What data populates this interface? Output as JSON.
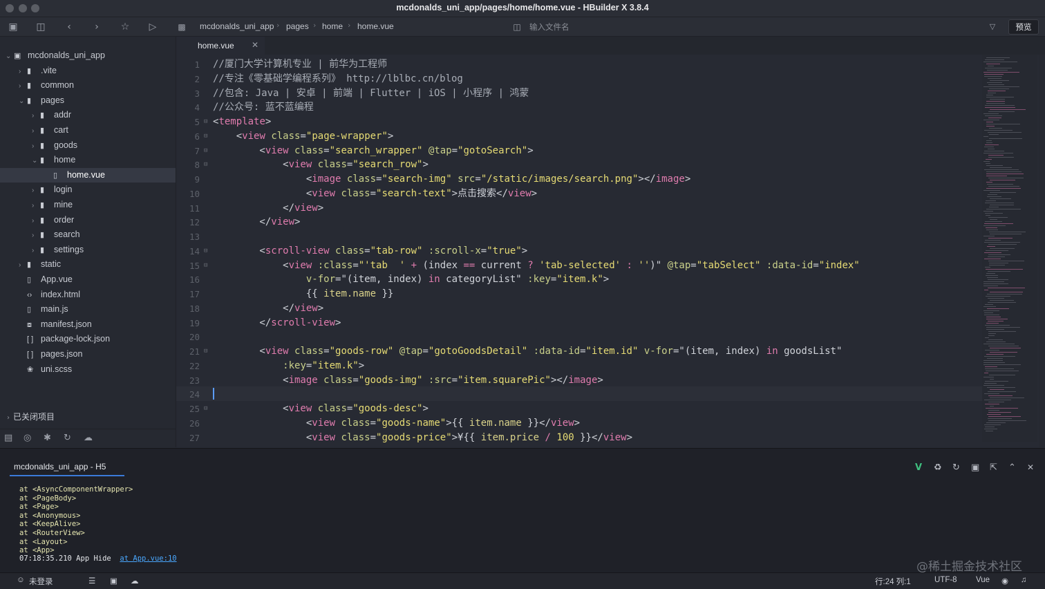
{
  "window": {
    "title": "mcdonalds_uni_app/pages/home/home.vue - HBuilder X 3.8.4"
  },
  "toolbar": {
    "breadcrumb": [
      "mcdonalds_uni_app",
      "pages",
      "home",
      "home.vue"
    ],
    "file_search_placeholder": "输入文件名",
    "preview_label": "预览"
  },
  "sidebar": {
    "items": [
      {
        "label": "mcdonalds_uni_app",
        "depth": 0,
        "kind": "project",
        "expanded": true
      },
      {
        "label": ".vite",
        "depth": 1,
        "kind": "folder",
        "expanded": false
      },
      {
        "label": "common",
        "depth": 1,
        "kind": "folder",
        "expanded": false
      },
      {
        "label": "pages",
        "depth": 1,
        "kind": "folder",
        "expanded": true
      },
      {
        "label": "addr",
        "depth": 2,
        "kind": "folder",
        "expanded": false
      },
      {
        "label": "cart",
        "depth": 2,
        "kind": "folder",
        "expanded": false
      },
      {
        "label": "goods",
        "depth": 2,
        "kind": "folder",
        "expanded": false
      },
      {
        "label": "home",
        "depth": 2,
        "kind": "folder",
        "expanded": true
      },
      {
        "label": "home.vue",
        "depth": 3,
        "kind": "file",
        "selected": true
      },
      {
        "label": "login",
        "depth": 2,
        "kind": "folder",
        "expanded": false
      },
      {
        "label": "mine",
        "depth": 2,
        "kind": "folder",
        "expanded": false
      },
      {
        "label": "order",
        "depth": 2,
        "kind": "folder",
        "expanded": false
      },
      {
        "label": "search",
        "depth": 2,
        "kind": "folder",
        "expanded": false
      },
      {
        "label": "settings",
        "depth": 2,
        "kind": "folder",
        "expanded": false
      },
      {
        "label": "static",
        "depth": 1,
        "kind": "folder",
        "expanded": false
      },
      {
        "label": "App.vue",
        "depth": 1,
        "kind": "file"
      },
      {
        "label": "index.html",
        "depth": 1,
        "kind": "html"
      },
      {
        "label": "main.js",
        "depth": 1,
        "kind": "file"
      },
      {
        "label": "manifest.json",
        "depth": 1,
        "kind": "manifest"
      },
      {
        "label": "package-lock.json",
        "depth": 1,
        "kind": "json"
      },
      {
        "label": "pages.json",
        "depth": 1,
        "kind": "json"
      },
      {
        "label": "uni.scss",
        "depth": 1,
        "kind": "scss"
      }
    ],
    "closed_projects_label": "已关闭项目"
  },
  "editor": {
    "tab_label": "home.vue",
    "cursor_line": 24,
    "lines": [
      {
        "n": "1",
        "fold": false,
        "tokens": [
          [
            "c-cm",
            "//厦门大学计算机专业 | 前华为工程师"
          ]
        ]
      },
      {
        "n": "2",
        "fold": false,
        "tokens": [
          [
            "c-cm",
            "//专注《零基础学编程系列》 http://lblbc.cn/blog"
          ]
        ]
      },
      {
        "n": "3",
        "fold": false,
        "tokens": [
          [
            "c-cm",
            "//包含: Java | 安卓 | 前端 | Flutter | iOS | 小程序 | 鸿蒙"
          ]
        ]
      },
      {
        "n": "4",
        "fold": false,
        "tokens": [
          [
            "c-cm",
            "//公众号: 蓝不蓝编程"
          ]
        ]
      },
      {
        "n": "5",
        "fold": true,
        "tokens": [
          [
            "c-plain",
            "<"
          ],
          [
            "c-tag",
            "template"
          ],
          [
            "c-plain",
            ">"
          ]
        ]
      },
      {
        "n": "6",
        "fold": true,
        "tokens": [
          [
            "c-plain",
            "    <"
          ],
          [
            "c-tag",
            "view"
          ],
          [
            "c-plain",
            " "
          ],
          [
            "c-attr",
            "class"
          ],
          [
            "c-plain",
            "="
          ],
          [
            "c-str",
            "\"page-wrapper\""
          ],
          [
            "c-plain",
            ">"
          ]
        ]
      },
      {
        "n": "7",
        "fold": true,
        "tokens": [
          [
            "c-plain",
            "        <"
          ],
          [
            "c-tag",
            "view"
          ],
          [
            "c-plain",
            " "
          ],
          [
            "c-attr",
            "class"
          ],
          [
            "c-plain",
            "="
          ],
          [
            "c-str",
            "\"search_wrapper\""
          ],
          [
            "c-plain",
            " "
          ],
          [
            "c-attr",
            "@tap"
          ],
          [
            "c-plain",
            "="
          ],
          [
            "c-str",
            "\"gotoSearch\""
          ],
          [
            "c-plain",
            ">"
          ]
        ]
      },
      {
        "n": "8",
        "fold": true,
        "tokens": [
          [
            "c-plain",
            "            <"
          ],
          [
            "c-tag",
            "view"
          ],
          [
            "c-plain",
            " "
          ],
          [
            "c-attr",
            "class"
          ],
          [
            "c-plain",
            "="
          ],
          [
            "c-str",
            "\"search_row\""
          ],
          [
            "c-plain",
            ">"
          ]
        ]
      },
      {
        "n": "9",
        "fold": false,
        "tokens": [
          [
            "c-plain",
            "                <"
          ],
          [
            "c-tag",
            "image"
          ],
          [
            "c-plain",
            " "
          ],
          [
            "c-attr",
            "class"
          ],
          [
            "c-plain",
            "="
          ],
          [
            "c-str",
            "\"search-img\""
          ],
          [
            "c-plain",
            " "
          ],
          [
            "c-attr",
            "src"
          ],
          [
            "c-plain",
            "="
          ],
          [
            "c-str",
            "\"/static/images/search.png\""
          ],
          [
            "c-plain",
            "></"
          ],
          [
            "c-tag",
            "image"
          ],
          [
            "c-plain",
            ">"
          ]
        ]
      },
      {
        "n": "10",
        "fold": false,
        "tokens": [
          [
            "c-plain",
            "                <"
          ],
          [
            "c-tag",
            "view"
          ],
          [
            "c-plain",
            " "
          ],
          [
            "c-attr",
            "class"
          ],
          [
            "c-plain",
            "="
          ],
          [
            "c-str",
            "\"search-text\""
          ],
          [
            "c-plain",
            ">点击搜索</"
          ],
          [
            "c-tag",
            "view"
          ],
          [
            "c-plain",
            ">"
          ]
        ]
      },
      {
        "n": "11",
        "fold": false,
        "tokens": [
          [
            "c-plain",
            "            </"
          ],
          [
            "c-tag",
            "view"
          ],
          [
            "c-plain",
            ">"
          ]
        ]
      },
      {
        "n": "12",
        "fold": false,
        "tokens": [
          [
            "c-plain",
            "        </"
          ],
          [
            "c-tag",
            "view"
          ],
          [
            "c-plain",
            ">"
          ]
        ]
      },
      {
        "n": "13",
        "fold": false,
        "tokens": []
      },
      {
        "n": "14",
        "fold": true,
        "tokens": [
          [
            "c-plain",
            "        <"
          ],
          [
            "c-tag",
            "scroll-view"
          ],
          [
            "c-plain",
            " "
          ],
          [
            "c-attr",
            "class"
          ],
          [
            "c-plain",
            "="
          ],
          [
            "c-str",
            "\"tab-row\""
          ],
          [
            "c-plain",
            " "
          ],
          [
            "c-attr",
            ":scroll-x"
          ],
          [
            "c-plain",
            "="
          ],
          [
            "c-str",
            "\"true\""
          ],
          [
            "c-plain",
            ">"
          ]
        ]
      },
      {
        "n": "15",
        "fold": true,
        "tokens": [
          [
            "c-plain",
            "            <"
          ],
          [
            "c-tag",
            "view"
          ],
          [
            "c-plain",
            " "
          ],
          [
            "c-attr",
            ":class"
          ],
          [
            "c-plain",
            "="
          ],
          [
            "c-str",
            "\"'tab  '"
          ],
          [
            "c-plain",
            " "
          ],
          [
            "c-kw",
            "+"
          ],
          [
            "c-plain",
            " (index "
          ],
          [
            "c-kw",
            "=="
          ],
          [
            "c-plain",
            " current "
          ],
          [
            "c-kw",
            "?"
          ],
          [
            "c-plain",
            " "
          ],
          [
            "c-str",
            "'tab-selected'"
          ],
          [
            "c-plain",
            " "
          ],
          [
            "c-kw",
            ":"
          ],
          [
            "c-plain",
            " "
          ],
          [
            "c-str",
            "''"
          ],
          [
            "c-plain",
            ")\" "
          ],
          [
            "c-attr",
            "@tap"
          ],
          [
            "c-plain",
            "="
          ],
          [
            "c-str",
            "\"tabSelect\""
          ],
          [
            "c-plain",
            " "
          ],
          [
            "c-attr",
            ":data-id"
          ],
          [
            "c-plain",
            "="
          ],
          [
            "c-str",
            "\"index\""
          ]
        ]
      },
      {
        "n": "16",
        "fold": false,
        "tokens": [
          [
            "c-plain",
            "                "
          ],
          [
            "c-attr",
            "v-for"
          ],
          [
            "c-plain",
            "=\"(item, index) "
          ],
          [
            "c-kw",
            "in"
          ],
          [
            "c-plain",
            " categoryList\" "
          ],
          [
            "c-attr",
            ":key"
          ],
          [
            "c-plain",
            "="
          ],
          [
            "c-str",
            "\"item.k\""
          ],
          [
            "c-plain",
            ">"
          ]
        ]
      },
      {
        "n": "17",
        "fold": false,
        "tokens": [
          [
            "c-plain",
            "                {{ "
          ],
          [
            "c-dir",
            "item.name"
          ],
          [
            "c-plain",
            " }}"
          ]
        ]
      },
      {
        "n": "18",
        "fold": false,
        "tokens": [
          [
            "c-plain",
            "            </"
          ],
          [
            "c-tag",
            "view"
          ],
          [
            "c-plain",
            ">"
          ]
        ]
      },
      {
        "n": "19",
        "fold": false,
        "tokens": [
          [
            "c-plain",
            "        </"
          ],
          [
            "c-tag",
            "scroll-view"
          ],
          [
            "c-plain",
            ">"
          ]
        ]
      },
      {
        "n": "20",
        "fold": false,
        "tokens": []
      },
      {
        "n": "21",
        "fold": true,
        "tokens": [
          [
            "c-plain",
            "        <"
          ],
          [
            "c-tag",
            "view"
          ],
          [
            "c-plain",
            " "
          ],
          [
            "c-attr",
            "class"
          ],
          [
            "c-plain",
            "="
          ],
          [
            "c-str",
            "\"goods-row\""
          ],
          [
            "c-plain",
            " "
          ],
          [
            "c-attr",
            "@tap"
          ],
          [
            "c-plain",
            "="
          ],
          [
            "c-str",
            "\"gotoGoodsDetail\""
          ],
          [
            "c-plain",
            " "
          ],
          [
            "c-attr",
            ":data-id"
          ],
          [
            "c-plain",
            "="
          ],
          [
            "c-str",
            "\"item.id\""
          ],
          [
            "c-plain",
            " "
          ],
          [
            "c-attr",
            "v-for"
          ],
          [
            "c-plain",
            "=\"(item, index) "
          ],
          [
            "c-kw",
            "in"
          ],
          [
            "c-plain",
            " goodsList\""
          ]
        ]
      },
      {
        "n": "22",
        "fold": false,
        "tokens": [
          [
            "c-plain",
            "            "
          ],
          [
            "c-attr",
            ":key"
          ],
          [
            "c-plain",
            "="
          ],
          [
            "c-str",
            "\"item.k\""
          ],
          [
            "c-plain",
            ">"
          ]
        ]
      },
      {
        "n": "23",
        "fold": false,
        "tokens": [
          [
            "c-plain",
            "            <"
          ],
          [
            "c-tag",
            "image"
          ],
          [
            "c-plain",
            " "
          ],
          [
            "c-attr",
            "class"
          ],
          [
            "c-plain",
            "="
          ],
          [
            "c-str",
            "\"goods-img\""
          ],
          [
            "c-plain",
            " "
          ],
          [
            "c-attr",
            ":src"
          ],
          [
            "c-plain",
            "="
          ],
          [
            "c-str",
            "\"item.squarePic\""
          ],
          [
            "c-plain",
            "></"
          ],
          [
            "c-tag",
            "image"
          ],
          [
            "c-plain",
            ">"
          ]
        ]
      },
      {
        "n": "24",
        "fold": false,
        "tokens": []
      },
      {
        "n": "25",
        "fold": true,
        "tokens": [
          [
            "c-plain",
            "            <"
          ],
          [
            "c-tag",
            "view"
          ],
          [
            "c-plain",
            " "
          ],
          [
            "c-attr",
            "class"
          ],
          [
            "c-plain",
            "="
          ],
          [
            "c-str",
            "\"goods-desc\""
          ],
          [
            "c-plain",
            ">"
          ]
        ]
      },
      {
        "n": "26",
        "fold": false,
        "tokens": [
          [
            "c-plain",
            "                <"
          ],
          [
            "c-tag",
            "view"
          ],
          [
            "c-plain",
            " "
          ],
          [
            "c-attr",
            "class"
          ],
          [
            "c-plain",
            "="
          ],
          [
            "c-str",
            "\"goods-name\""
          ],
          [
            "c-plain",
            ">{{ "
          ],
          [
            "c-dir",
            "item.name"
          ],
          [
            "c-plain",
            " }}</"
          ],
          [
            "c-tag",
            "view"
          ],
          [
            "c-plain",
            ">"
          ]
        ]
      },
      {
        "n": "27",
        "fold": false,
        "tokens": [
          [
            "c-plain",
            "                <"
          ],
          [
            "c-tag",
            "view"
          ],
          [
            "c-plain",
            " "
          ],
          [
            "c-attr",
            "class"
          ],
          [
            "c-plain",
            "="
          ],
          [
            "c-str",
            "\"goods-price\""
          ],
          [
            "c-plain",
            ">¥{{ "
          ],
          [
            "c-dir",
            "item.price"
          ],
          [
            "c-plain",
            " "
          ],
          [
            "c-kw",
            "/"
          ],
          [
            "c-plain",
            " "
          ],
          [
            "c-str",
            "100"
          ],
          [
            "c-plain",
            " }}</"
          ],
          [
            "c-tag",
            "view"
          ],
          [
            "c-plain",
            ">"
          ]
        ]
      }
    ]
  },
  "console": {
    "tab_label": "mcdonalds_uni_app - H5",
    "lines": [
      {
        "text": "at <AsyncComponentWrapper>"
      },
      {
        "text": "at <PageBody>"
      },
      {
        "text": "at <Page>"
      },
      {
        "text": "at <Anonymous>"
      },
      {
        "text": "at <KeepAlive>"
      },
      {
        "text": "at <RouterView>"
      },
      {
        "text": "at <Layout>"
      },
      {
        "text": "at <App>"
      }
    ],
    "last_line_text": "07:18:35.210 App Hide  ",
    "last_line_link": "at App.vue:10"
  },
  "statusbar": {
    "login": "未登录",
    "position": "行:24  列:1",
    "encoding": "UTF-8",
    "language": "Vue"
  },
  "watermark": "@稀土掘金技术社区",
  "colors": {
    "accent": "#3b7bd9",
    "editor_bg": "#272a33",
    "string": "#e6db74",
    "tag": "#e07cae"
  }
}
